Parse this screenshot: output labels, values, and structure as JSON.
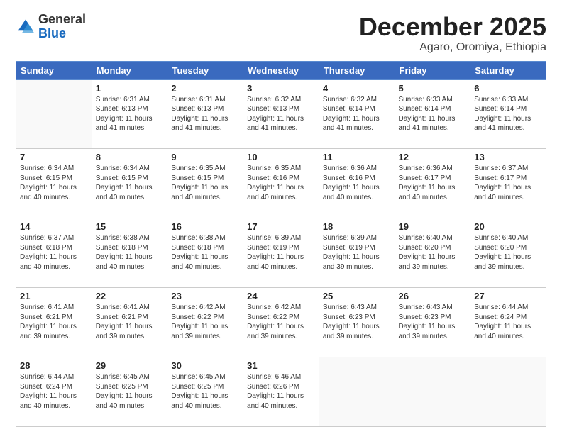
{
  "logo": {
    "general": "General",
    "blue": "Blue"
  },
  "header": {
    "month": "December 2025",
    "location": "Agaro, Oromiya, Ethiopia"
  },
  "days_of_week": [
    "Sunday",
    "Monday",
    "Tuesday",
    "Wednesday",
    "Thursday",
    "Friday",
    "Saturday"
  ],
  "weeks": [
    [
      {
        "day": "",
        "info": ""
      },
      {
        "day": "1",
        "info": "Sunrise: 6:31 AM\nSunset: 6:13 PM\nDaylight: 11 hours and 41 minutes."
      },
      {
        "day": "2",
        "info": "Sunrise: 6:31 AM\nSunset: 6:13 PM\nDaylight: 11 hours and 41 minutes."
      },
      {
        "day": "3",
        "info": "Sunrise: 6:32 AM\nSunset: 6:13 PM\nDaylight: 11 hours and 41 minutes."
      },
      {
        "day": "4",
        "info": "Sunrise: 6:32 AM\nSunset: 6:14 PM\nDaylight: 11 hours and 41 minutes."
      },
      {
        "day": "5",
        "info": "Sunrise: 6:33 AM\nSunset: 6:14 PM\nDaylight: 11 hours and 41 minutes."
      },
      {
        "day": "6",
        "info": "Sunrise: 6:33 AM\nSunset: 6:14 PM\nDaylight: 11 hours and 41 minutes."
      }
    ],
    [
      {
        "day": "7",
        "info": "Sunrise: 6:34 AM\nSunset: 6:15 PM\nDaylight: 11 hours and 40 minutes."
      },
      {
        "day": "8",
        "info": "Sunrise: 6:34 AM\nSunset: 6:15 PM\nDaylight: 11 hours and 40 minutes."
      },
      {
        "day": "9",
        "info": "Sunrise: 6:35 AM\nSunset: 6:15 PM\nDaylight: 11 hours and 40 minutes."
      },
      {
        "day": "10",
        "info": "Sunrise: 6:35 AM\nSunset: 6:16 PM\nDaylight: 11 hours and 40 minutes."
      },
      {
        "day": "11",
        "info": "Sunrise: 6:36 AM\nSunset: 6:16 PM\nDaylight: 11 hours and 40 minutes."
      },
      {
        "day": "12",
        "info": "Sunrise: 6:36 AM\nSunset: 6:17 PM\nDaylight: 11 hours and 40 minutes."
      },
      {
        "day": "13",
        "info": "Sunrise: 6:37 AM\nSunset: 6:17 PM\nDaylight: 11 hours and 40 minutes."
      }
    ],
    [
      {
        "day": "14",
        "info": "Sunrise: 6:37 AM\nSunset: 6:18 PM\nDaylight: 11 hours and 40 minutes."
      },
      {
        "day": "15",
        "info": "Sunrise: 6:38 AM\nSunset: 6:18 PM\nDaylight: 11 hours and 40 minutes."
      },
      {
        "day": "16",
        "info": "Sunrise: 6:38 AM\nSunset: 6:18 PM\nDaylight: 11 hours and 40 minutes."
      },
      {
        "day": "17",
        "info": "Sunrise: 6:39 AM\nSunset: 6:19 PM\nDaylight: 11 hours and 40 minutes."
      },
      {
        "day": "18",
        "info": "Sunrise: 6:39 AM\nSunset: 6:19 PM\nDaylight: 11 hours and 39 minutes."
      },
      {
        "day": "19",
        "info": "Sunrise: 6:40 AM\nSunset: 6:20 PM\nDaylight: 11 hours and 39 minutes."
      },
      {
        "day": "20",
        "info": "Sunrise: 6:40 AM\nSunset: 6:20 PM\nDaylight: 11 hours and 39 minutes."
      }
    ],
    [
      {
        "day": "21",
        "info": "Sunrise: 6:41 AM\nSunset: 6:21 PM\nDaylight: 11 hours and 39 minutes."
      },
      {
        "day": "22",
        "info": "Sunrise: 6:41 AM\nSunset: 6:21 PM\nDaylight: 11 hours and 39 minutes."
      },
      {
        "day": "23",
        "info": "Sunrise: 6:42 AM\nSunset: 6:22 PM\nDaylight: 11 hours and 39 minutes."
      },
      {
        "day": "24",
        "info": "Sunrise: 6:42 AM\nSunset: 6:22 PM\nDaylight: 11 hours and 39 minutes."
      },
      {
        "day": "25",
        "info": "Sunrise: 6:43 AM\nSunset: 6:23 PM\nDaylight: 11 hours and 39 minutes."
      },
      {
        "day": "26",
        "info": "Sunrise: 6:43 AM\nSunset: 6:23 PM\nDaylight: 11 hours and 39 minutes."
      },
      {
        "day": "27",
        "info": "Sunrise: 6:44 AM\nSunset: 6:24 PM\nDaylight: 11 hours and 40 minutes."
      }
    ],
    [
      {
        "day": "28",
        "info": "Sunrise: 6:44 AM\nSunset: 6:24 PM\nDaylight: 11 hours and 40 minutes."
      },
      {
        "day": "29",
        "info": "Sunrise: 6:45 AM\nSunset: 6:25 PM\nDaylight: 11 hours and 40 minutes."
      },
      {
        "day": "30",
        "info": "Sunrise: 6:45 AM\nSunset: 6:25 PM\nDaylight: 11 hours and 40 minutes."
      },
      {
        "day": "31",
        "info": "Sunrise: 6:46 AM\nSunset: 6:26 PM\nDaylight: 11 hours and 40 minutes."
      },
      {
        "day": "",
        "info": ""
      },
      {
        "day": "",
        "info": ""
      },
      {
        "day": "",
        "info": ""
      }
    ]
  ]
}
